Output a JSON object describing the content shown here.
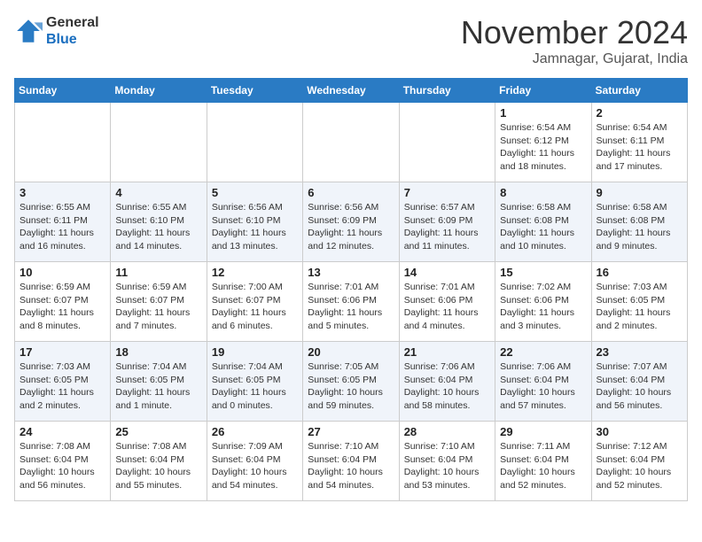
{
  "header": {
    "logo_line1": "General",
    "logo_line2": "Blue",
    "month": "November 2024",
    "location": "Jamnagar, Gujarat, India"
  },
  "days_of_week": [
    "Sunday",
    "Monday",
    "Tuesday",
    "Wednesday",
    "Thursday",
    "Friday",
    "Saturday"
  ],
  "weeks": [
    [
      {
        "day": "",
        "info": ""
      },
      {
        "day": "",
        "info": ""
      },
      {
        "day": "",
        "info": ""
      },
      {
        "day": "",
        "info": ""
      },
      {
        "day": "",
        "info": ""
      },
      {
        "day": "1",
        "info": "Sunrise: 6:54 AM\nSunset: 6:12 PM\nDaylight: 11 hours and 18 minutes."
      },
      {
        "day": "2",
        "info": "Sunrise: 6:54 AM\nSunset: 6:11 PM\nDaylight: 11 hours and 17 minutes."
      }
    ],
    [
      {
        "day": "3",
        "info": "Sunrise: 6:55 AM\nSunset: 6:11 PM\nDaylight: 11 hours and 16 minutes."
      },
      {
        "day": "4",
        "info": "Sunrise: 6:55 AM\nSunset: 6:10 PM\nDaylight: 11 hours and 14 minutes."
      },
      {
        "day": "5",
        "info": "Sunrise: 6:56 AM\nSunset: 6:10 PM\nDaylight: 11 hours and 13 minutes."
      },
      {
        "day": "6",
        "info": "Sunrise: 6:56 AM\nSunset: 6:09 PM\nDaylight: 11 hours and 12 minutes."
      },
      {
        "day": "7",
        "info": "Sunrise: 6:57 AM\nSunset: 6:09 PM\nDaylight: 11 hours and 11 minutes."
      },
      {
        "day": "8",
        "info": "Sunrise: 6:58 AM\nSunset: 6:08 PM\nDaylight: 11 hours and 10 minutes."
      },
      {
        "day": "9",
        "info": "Sunrise: 6:58 AM\nSunset: 6:08 PM\nDaylight: 11 hours and 9 minutes."
      }
    ],
    [
      {
        "day": "10",
        "info": "Sunrise: 6:59 AM\nSunset: 6:07 PM\nDaylight: 11 hours and 8 minutes."
      },
      {
        "day": "11",
        "info": "Sunrise: 6:59 AM\nSunset: 6:07 PM\nDaylight: 11 hours and 7 minutes."
      },
      {
        "day": "12",
        "info": "Sunrise: 7:00 AM\nSunset: 6:07 PM\nDaylight: 11 hours and 6 minutes."
      },
      {
        "day": "13",
        "info": "Sunrise: 7:01 AM\nSunset: 6:06 PM\nDaylight: 11 hours and 5 minutes."
      },
      {
        "day": "14",
        "info": "Sunrise: 7:01 AM\nSunset: 6:06 PM\nDaylight: 11 hours and 4 minutes."
      },
      {
        "day": "15",
        "info": "Sunrise: 7:02 AM\nSunset: 6:06 PM\nDaylight: 11 hours and 3 minutes."
      },
      {
        "day": "16",
        "info": "Sunrise: 7:03 AM\nSunset: 6:05 PM\nDaylight: 11 hours and 2 minutes."
      }
    ],
    [
      {
        "day": "17",
        "info": "Sunrise: 7:03 AM\nSunset: 6:05 PM\nDaylight: 11 hours and 2 minutes."
      },
      {
        "day": "18",
        "info": "Sunrise: 7:04 AM\nSunset: 6:05 PM\nDaylight: 11 hours and 1 minute."
      },
      {
        "day": "19",
        "info": "Sunrise: 7:04 AM\nSunset: 6:05 PM\nDaylight: 11 hours and 0 minutes."
      },
      {
        "day": "20",
        "info": "Sunrise: 7:05 AM\nSunset: 6:05 PM\nDaylight: 10 hours and 59 minutes."
      },
      {
        "day": "21",
        "info": "Sunrise: 7:06 AM\nSunset: 6:04 PM\nDaylight: 10 hours and 58 minutes."
      },
      {
        "day": "22",
        "info": "Sunrise: 7:06 AM\nSunset: 6:04 PM\nDaylight: 10 hours and 57 minutes."
      },
      {
        "day": "23",
        "info": "Sunrise: 7:07 AM\nSunset: 6:04 PM\nDaylight: 10 hours and 56 minutes."
      }
    ],
    [
      {
        "day": "24",
        "info": "Sunrise: 7:08 AM\nSunset: 6:04 PM\nDaylight: 10 hours and 56 minutes."
      },
      {
        "day": "25",
        "info": "Sunrise: 7:08 AM\nSunset: 6:04 PM\nDaylight: 10 hours and 55 minutes."
      },
      {
        "day": "26",
        "info": "Sunrise: 7:09 AM\nSunset: 6:04 PM\nDaylight: 10 hours and 54 minutes."
      },
      {
        "day": "27",
        "info": "Sunrise: 7:10 AM\nSunset: 6:04 PM\nDaylight: 10 hours and 54 minutes."
      },
      {
        "day": "28",
        "info": "Sunrise: 7:10 AM\nSunset: 6:04 PM\nDaylight: 10 hours and 53 minutes."
      },
      {
        "day": "29",
        "info": "Sunrise: 7:11 AM\nSunset: 6:04 PM\nDaylight: 10 hours and 52 minutes."
      },
      {
        "day": "30",
        "info": "Sunrise: 7:12 AM\nSunset: 6:04 PM\nDaylight: 10 hours and 52 minutes."
      }
    ]
  ]
}
